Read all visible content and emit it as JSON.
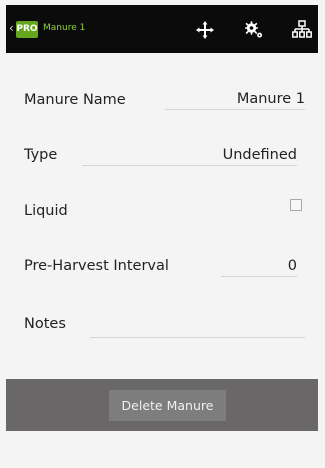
{
  "app": {
    "back_icon": "chevron-left-icon",
    "badge": "PRO",
    "title": "Manure 1",
    "colors": {
      "header_bg": "#0b0b0b",
      "badge_bg": "#66a61e",
      "title_color": "#8fd33a",
      "delete_panel_bg": "#696767"
    }
  },
  "toolbar": {
    "icons": [
      "move-icon",
      "settings-icon",
      "hierarchy-icon"
    ]
  },
  "form": {
    "manure_name": {
      "label": "Manure Name",
      "value": "Manure 1"
    },
    "type": {
      "label": "Type",
      "value": "Undefined"
    },
    "liquid": {
      "label": "Liquid",
      "checked": false
    },
    "pre_harvest_interval": {
      "label": "Pre-Harvest Interval",
      "value": "0"
    },
    "notes": {
      "label": "Notes",
      "value": ""
    }
  },
  "actions": {
    "delete_label": "Delete Manure"
  }
}
